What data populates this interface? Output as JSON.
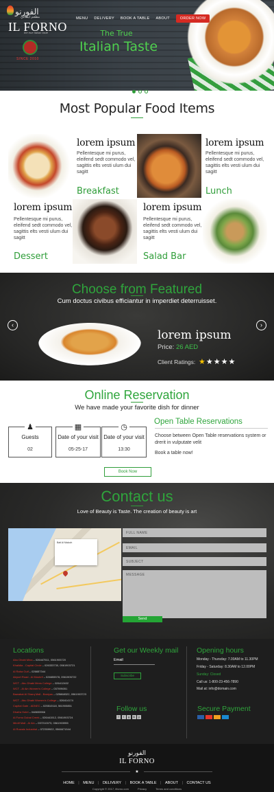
{
  "header": {
    "logo_arabic": "الفورنو",
    "logo_arabic_sub": "مطعم ايطالي",
    "logo_name": "IL FORNO",
    "logo_tagline": "the true Italian taste",
    "badge_text": "SINCE 2010",
    "nav": [
      "MENU",
      "DELIVERY",
      "BOOK A TABLE",
      "ABOUT"
    ],
    "order_button": "ORDER NOW",
    "hero_line1": "The True",
    "hero_line2": "Italian Taste",
    "slider_dots": 3,
    "active_dot": 1
  },
  "popular": {
    "heading": "Most Popular Food Items",
    "items": [
      {
        "title": "lorem ipsum",
        "desc": "Pellentesque mi purus, eleifend sedt commodo vel, sagittis elts vesti ulum dui sagitt",
        "category": "Breakfast"
      },
      {
        "title": "lorem ipsum",
        "desc": "Pellentesque mi purus, eleifend sedt commodo vel, sagittis elts vesti ulum dui sagitt",
        "category": "Lunch"
      },
      {
        "title": "lorem ipsum",
        "desc": "Pellentesque mi purus, eleifend sedt commodo vel, sagittis elts vesti ulum dui sagitt",
        "category": "Dessert"
      },
      {
        "title": "lorem ipsum",
        "desc": "Pellentesque mi purus, eleifend sedt commodo vel, sagittis elts vesti ulum dui sagitt",
        "category": "Salad Bar"
      }
    ]
  },
  "featured": {
    "heading": "Choose from Featured",
    "subheading": "Cum doctus civibus efficiantur in imperdiet deterruisset.",
    "name": "lorem ipsum",
    "price_label": "Price:",
    "price_value": "26 AED",
    "rating_label": "Client Ratings:",
    "rating": 5,
    "prev_icon": "chevron-left-icon",
    "next_icon": "chevron-right-icon"
  },
  "reservation": {
    "heading": "Online Reservation",
    "subheading": "We have made your favorite dish for dinner",
    "boxes": [
      {
        "label": "Guests",
        "value": "02",
        "icon": "users-icon"
      },
      {
        "label": "Date of your visit",
        "value": "05-25-17",
        "icon": "calendar-icon"
      },
      {
        "label": "Date of your visit",
        "value": "13:30",
        "icon": "clock-icon"
      }
    ],
    "open_table_title": "Open Table Reservations",
    "open_table_desc": "Choose between Open Table reservations system or drerit in vulputate velit",
    "book_text": "Book a table now!",
    "book_button": "Book Now"
  },
  "contact": {
    "heading": "Contact us",
    "subheading": "Love of Beauty is Taste. The creation of beauty is art",
    "map_info": "Bait Al Malooh",
    "fields": {
      "name": "FULL NAME",
      "email": "EMAIL",
      "subject": "SUBJECT",
      "message": "MESSAGE"
    },
    "send_button": "Send"
  },
  "footer": {
    "locations_title": "Locations",
    "locations": [
      {
        "name": "Abu Dhabi Mina",
        "phones": "026447511, 0561905720"
      },
      {
        "name": "Khalidia - Capital Circle",
        "phones": "026333730, 0561903721"
      },
      {
        "name": "Al Raha Gulf",
        "phones": "026657344"
      },
      {
        "name": "Airport Road - Al Mushrif",
        "phones": "026655578, 0561905722"
      },
      {
        "name": "WCT - Abu Dhabi Mens College",
        "phones": "026412402"
      },
      {
        "name": "WCT - Al Ain Women's College",
        "phones": "037095051"
      },
      {
        "name": "Bawabat Al Sharq Mall - Baniyas",
        "phones": "025868322, 0561903723"
      },
      {
        "name": "WCT - Abu Dhabi Women's College",
        "phones": "026414174"
      },
      {
        "name": "Capital Gate - ADNEC",
        "phones": "025510118, 561905851"
      },
      {
        "name": "Dhafra Hotel",
        "phones": "048833966"
      },
      {
        "name": "Al Forno Dubai Creek",
        "phones": "026441512, 0561903724"
      },
      {
        "name": "Mirdif Mall - Al Ain",
        "phones": "037210073, 0561903955"
      },
      {
        "name": "Al Ruwais Industrial",
        "phones": "072359922, 0566671544"
      }
    ],
    "weekly_title": "Get our Weekly mail",
    "email_label": "Email",
    "subscribe_button": "Subscribe",
    "follow_title": "Follow us",
    "social": [
      "f",
      "t",
      "g",
      "in",
      "y"
    ],
    "hours_title": "Opening hours",
    "hours": [
      "Monday - Thursday: 7.00AM to 11.30PM",
      "Friday - Saturday: 8.30AM to 12.00PM",
      "Sunday: Closed"
    ],
    "call": "Call us: 1-800-23-456-7890",
    "mail": "Mail at: info@domain.com",
    "secure_title": "Secure Payment",
    "cards": [
      "#2a5fa8",
      "#e6372c",
      "#f0a020",
      "#1a8ad1"
    ],
    "brand_arabic": "الفورنو",
    "brand_name": "IL FORNO",
    "nav": [
      "HOME",
      "MENU",
      "DELIVERY",
      "BOOK A TABLE",
      "ABOUT",
      "CONTACT US"
    ],
    "copyright": "Copyright © 2017, ilforno.com",
    "privacy": "Privacy",
    "terms": "Terms and conditions"
  }
}
